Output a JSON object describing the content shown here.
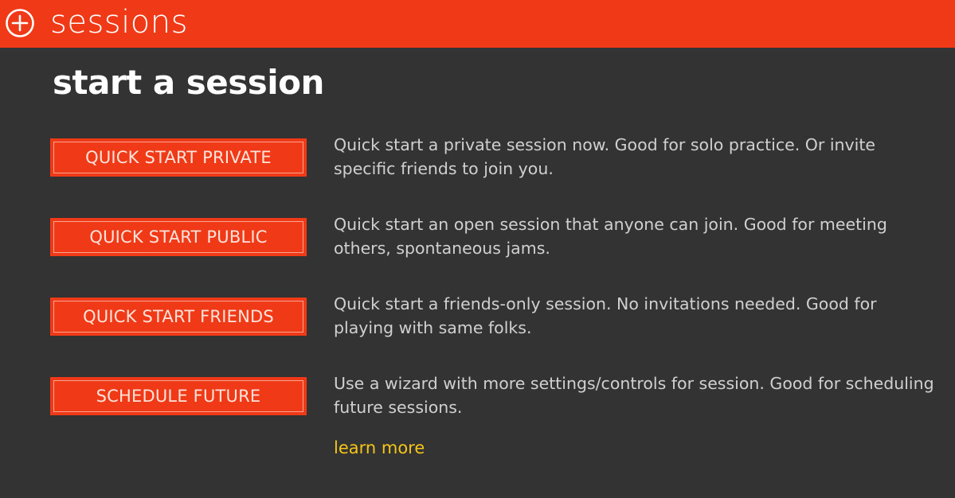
{
  "header": {
    "title": "sessions",
    "icon": "plus-circle-icon",
    "accent_color": "#f03a17"
  },
  "main": {
    "title": "start a session",
    "options": [
      {
        "button_label": "QUICK START PRIVATE",
        "description": "Quick start a private session now. Good for solo practice. Or invite specific friends to join you."
      },
      {
        "button_label": "QUICK START PUBLIC",
        "description": "Quick start an open session that anyone can join. Good for meeting others, spontaneous jams."
      },
      {
        "button_label": "QUICK START FRIENDS",
        "description": "Quick start a friends-only session. No invitations needed. Good for playing with same folks."
      },
      {
        "button_label": "SCHEDULE FUTURE",
        "description": "Use a wizard with more settings/controls for session. Good for scheduling future sessions."
      }
    ],
    "learn_more": "learn more",
    "link_color": "#f5c518"
  }
}
